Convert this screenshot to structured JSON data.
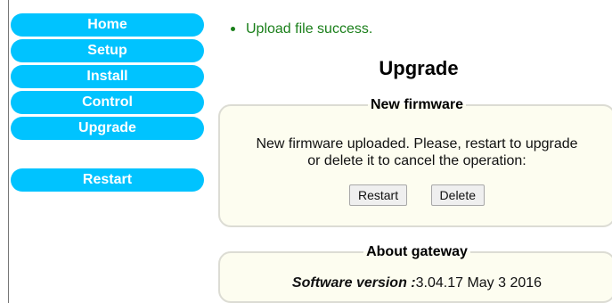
{
  "sidebar": {
    "items": [
      {
        "label": "Home"
      },
      {
        "label": "Setup"
      },
      {
        "label": "Install"
      },
      {
        "label": "Control"
      },
      {
        "label": "Upgrade"
      }
    ],
    "restart": {
      "label": "Restart"
    }
  },
  "status": {
    "message": "Upload file success."
  },
  "page": {
    "title": "Upgrade"
  },
  "new_firmware": {
    "legend": "New firmware",
    "line1": "New firmware uploaded. Please, restart to upgrade",
    "line2": "or delete it to cancel the operation:",
    "restart_label": "Restart",
    "delete_label": "Delete"
  },
  "about": {
    "legend": "About gateway",
    "software_label": "Software version :",
    "software_value": "3.04.17 May 3 2016"
  },
  "colors": {
    "nav_button": "#00c3ff",
    "status_text": "#1a7f1a",
    "panel_bg": "#fdfdf0"
  }
}
